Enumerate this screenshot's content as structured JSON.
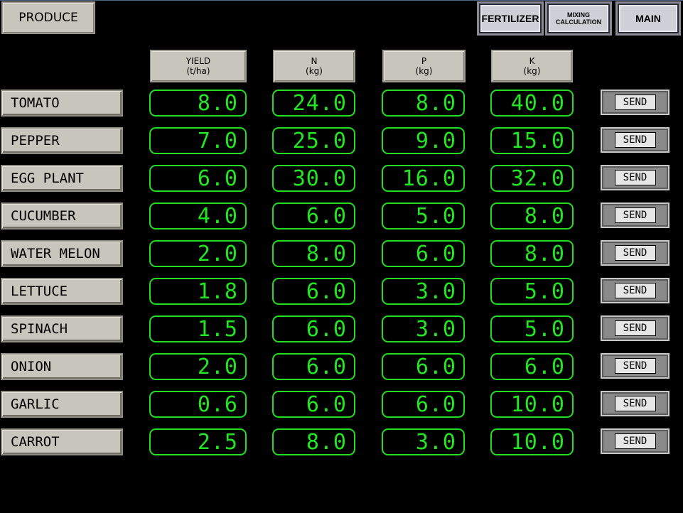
{
  "header": {
    "title": "PRODUCE",
    "nav": {
      "fertilizer": "FERTILIZER",
      "mixing_line1": "MIXING",
      "mixing_line2": "CALCULATION",
      "main": "MAIN"
    }
  },
  "columns": [
    {
      "label": "YIELD",
      "unit": "(t/ha)"
    },
    {
      "label": "N",
      "unit": "(kg)"
    },
    {
      "label": "P",
      "unit": "(kg)"
    },
    {
      "label": "K",
      "unit": "(kg)"
    }
  ],
  "send_label": "SEND",
  "rows": [
    {
      "crop": "TOMATO",
      "yield": "8.0",
      "n": "24.0",
      "p": "8.0",
      "k": "40.0"
    },
    {
      "crop": "PEPPER",
      "yield": "7.0",
      "n": "25.0",
      "p": "9.0",
      "k": "15.0"
    },
    {
      "crop": "EGG PLANT",
      "yield": "6.0",
      "n": "30.0",
      "p": "16.0",
      "k": "32.0"
    },
    {
      "crop": "CUCUMBER",
      "yield": "4.0",
      "n": "6.0",
      "p": "5.0",
      "k": "8.0"
    },
    {
      "crop": "WATER MELON",
      "yield": "2.0",
      "n": "8.0",
      "p": "6.0",
      "k": "8.0"
    },
    {
      "crop": "LETTUCE",
      "yield": "1.8",
      "n": "6.0",
      "p": "3.0",
      "k": "5.0"
    },
    {
      "crop": "SPINACH",
      "yield": "1.5",
      "n": "6.0",
      "p": "3.0",
      "k": "5.0"
    },
    {
      "crop": "ONION",
      "yield": "2.0",
      "n": "6.0",
      "p": "6.0",
      "k": "6.0"
    },
    {
      "crop": "GARLIC",
      "yield": "0.6",
      "n": "6.0",
      "p": "6.0",
      "k": "10.0"
    },
    {
      "crop": "CARROT",
      "yield": "2.5",
      "n": "8.0",
      "p": "3.0",
      "k": "10.0"
    }
  ],
  "colors": {
    "background": "#000000",
    "value_green": "#22e622",
    "button_gray": "#c8c6bc"
  }
}
